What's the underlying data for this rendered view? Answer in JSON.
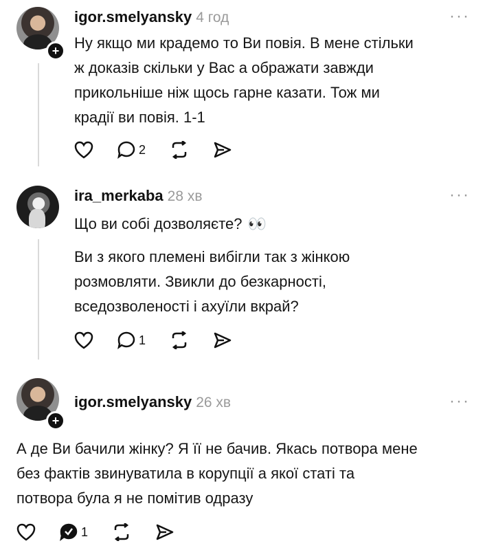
{
  "comments": [
    {
      "username": "igor.smelyansky",
      "time": "4 год",
      "more": "···",
      "lines": [
        "Ну якщо ми крадемо то Ви повія. В мене стільки",
        "ж доказів скільки у Вас а ображати завжди",
        "прикольніше ніж щось гарне казати. Тож ми",
        "крадії ви повія. 1-1"
      ],
      "reply_count": "2"
    },
    {
      "username": "ira_merkaba",
      "time": "28 хв",
      "more": "···",
      "line1": "Що ви собі дозволяєте?",
      "emoji": "👀",
      "lines": [
        "Ви з якого племені вибігли так з жінкою",
        "розмовляти. Звикли до безкарності,",
        "вседозволеності і ахуїли вкрай?"
      ],
      "reply_count": "1"
    },
    {
      "username": "igor.smelyansky",
      "time": "26 хв",
      "more": "···",
      "lines": [
        "А де Ви бачили жінку? Я її не бачив. Якась потвора мене",
        "без фактів звинуватила в корупції а якої статі та",
        "потвора була я не помітив одразу"
      ],
      "reply_count": "1"
    }
  ],
  "icons": [
    "heart-icon",
    "comment-icon",
    "repost-icon",
    "share-icon",
    "verified-comment-icon",
    "plus-icon"
  ]
}
